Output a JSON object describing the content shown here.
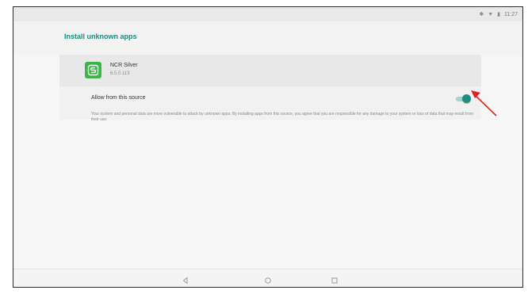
{
  "status_bar": {
    "icons": [
      "bluetooth-icon",
      "wifi-icon",
      "battery-icon"
    ],
    "time": "11:27"
  },
  "app_bar": {
    "title": "Install unknown apps"
  },
  "app": {
    "name": "NCR Silver",
    "version": "6.5.0.113",
    "icon": "ncr-silver-app-icon"
  },
  "setting": {
    "label": "Allow from this source",
    "enabled": true
  },
  "warning_text": "Your system and personal data are more vulnerable to attack by unknown apps. By installing apps from this source, you agree that you are responsible for any damage to your system or loss of data that may result from their use.",
  "nav": {
    "buttons": [
      "back-icon",
      "home-icon",
      "recents-icon"
    ]
  },
  "colors": {
    "accent": "#1e8e7e",
    "toggle_track": "#9ed6ce",
    "app_icon_green": "#3bb54a",
    "annotation_red": "#e02020"
  }
}
